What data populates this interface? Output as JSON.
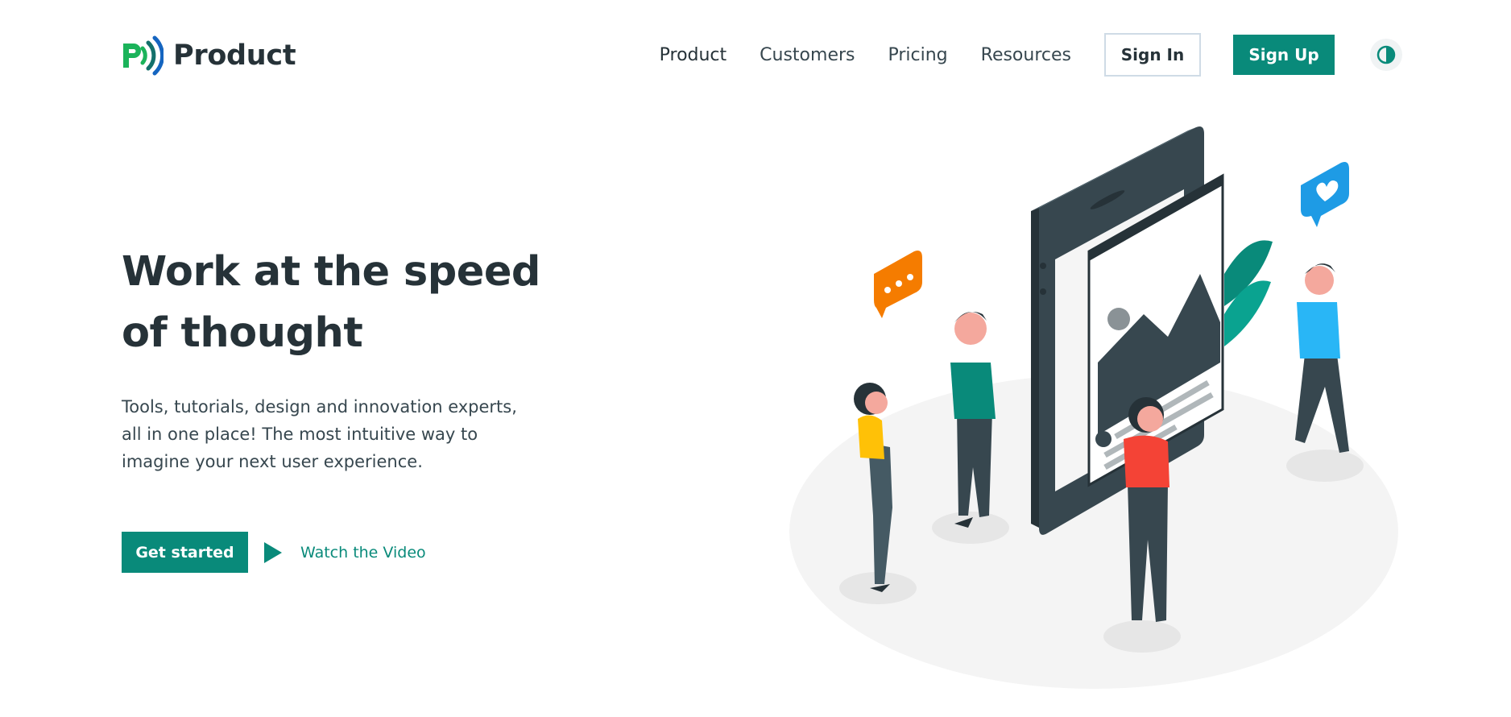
{
  "brand": {
    "name": "Product",
    "logo_icon": "product-logo-icon"
  },
  "nav": {
    "items": [
      {
        "label": "Product",
        "active": true
      },
      {
        "label": "Customers",
        "active": false
      },
      {
        "label": "Pricing",
        "active": false
      },
      {
        "label": "Resources",
        "active": false
      }
    ],
    "sign_in_label": "Sign In",
    "sign_up_label": "Sign Up",
    "theme_toggle_icon": "contrast-icon"
  },
  "hero": {
    "title_line1": "Work at the speed",
    "title_line2": "of thought",
    "description_line1": "Tools, tutorials, design and innovation experts,",
    "description_line2": "all in one place! The most intuitive way to",
    "description_line3": "imagine your next user experience.",
    "primary_cta_label": "Get started",
    "secondary_cta_label": "Watch the Video",
    "secondary_cta_icon": "play-icon"
  },
  "illustration": {
    "name": "people-with-phones-illustration"
  },
  "colors": {
    "accent": "#098a7a",
    "text_dark": "#263238",
    "logo_green": "#1bb35a",
    "logo_blue": "#1565c0",
    "shadow_ellipse": "#f4f4f4"
  }
}
